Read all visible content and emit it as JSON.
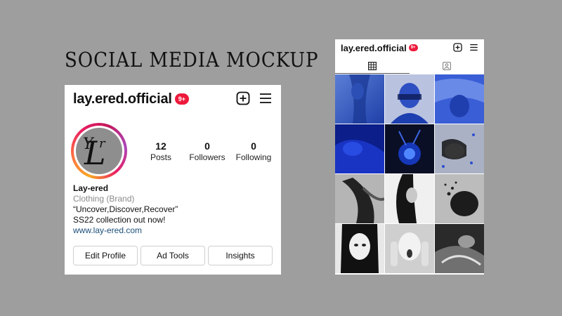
{
  "title": "SOCIAL MEDIA MOCKUP",
  "profile": {
    "username": "lay.ered.official",
    "badge": "9+",
    "stats": [
      {
        "value": "12",
        "label": "Posts"
      },
      {
        "value": "0",
        "label": "Followers"
      },
      {
        "value": "0",
        "label": "Following"
      }
    ],
    "avatar_text": "Yr",
    "bio": {
      "name": "Lay-ered",
      "category": "Clothing (Brand)",
      "line1": "“Uncover,Discover,Recover”",
      "line2": "SS22 collection out now!",
      "link": "www.lay-ered.com"
    },
    "buttons": [
      "Edit Profile",
      "Ad Tools",
      "Insights"
    ]
  },
  "phone": {
    "username": "lay.ered.official",
    "badge": "9+",
    "tabs": [
      "grid-icon",
      "tagged-icon"
    ]
  },
  "colors": {
    "background": "#9e9e9e",
    "badge": "#ed1a3c",
    "link": "#1b4e7a",
    "accent_blue": "#1a3dcc"
  }
}
